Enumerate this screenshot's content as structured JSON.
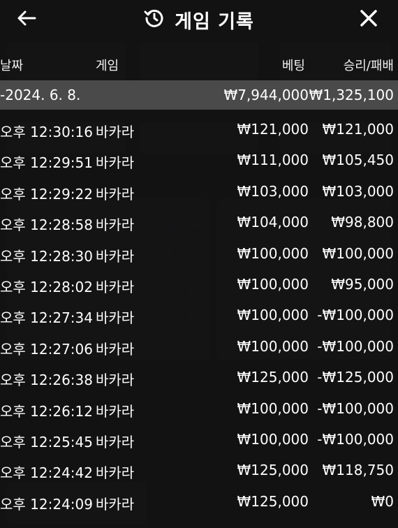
{
  "header": {
    "title": "게임 기록",
    "back_icon": "arrow-left-icon",
    "history_icon": "history-clock-icon",
    "close_icon": "close-icon"
  },
  "columns": {
    "date": "날짜",
    "game": "게임",
    "bet": "베팅",
    "result": "승리/패배"
  },
  "summary": {
    "date": "-2024. 6. 8.",
    "bet": "₩7,944,000",
    "result": "₩1,325,100"
  },
  "rows": [
    {
      "time": "오후 12:30:16",
      "game": "바카라",
      "bet": "₩121,000",
      "result": "₩121,000"
    },
    {
      "time": "오후 12:29:51",
      "game": "바카라",
      "bet": "₩111,000",
      "result": "₩105,450"
    },
    {
      "time": "오후 12:29:22",
      "game": "바카라",
      "bet": "₩103,000",
      "result": "₩103,000"
    },
    {
      "time": "오후 12:28:58",
      "game": "바카라",
      "bet": "₩104,000",
      "result": "₩98,800"
    },
    {
      "time": "오후 12:28:30",
      "game": "바카라",
      "bet": "₩100,000",
      "result": "₩100,000"
    },
    {
      "time": "오후 12:28:02",
      "game": "바카라",
      "bet": "₩100,000",
      "result": "₩95,000"
    },
    {
      "time": "오후 12:27:34",
      "game": "바카라",
      "bet": "₩100,000",
      "result": "-₩100,000"
    },
    {
      "time": "오후 12:27:06",
      "game": "바카라",
      "bet": "₩100,000",
      "result": "-₩100,000"
    },
    {
      "time": "오후 12:26:38",
      "game": "바카라",
      "bet": "₩125,000",
      "result": "-₩125,000"
    },
    {
      "time": "오후 12:26:12",
      "game": "바카라",
      "bet": "₩100,000",
      "result": "-₩100,000"
    },
    {
      "time": "오후 12:25:45",
      "game": "바카라",
      "bet": "₩100,000",
      "result": "-₩100,000"
    },
    {
      "time": "오후 12:24:42",
      "game": "바카라",
      "bet": "₩125,000",
      "result": "₩118,750"
    },
    {
      "time": "오후 12:24:09",
      "game": "바카라",
      "bet": "₩125,000",
      "result": "₩0"
    }
  ]
}
